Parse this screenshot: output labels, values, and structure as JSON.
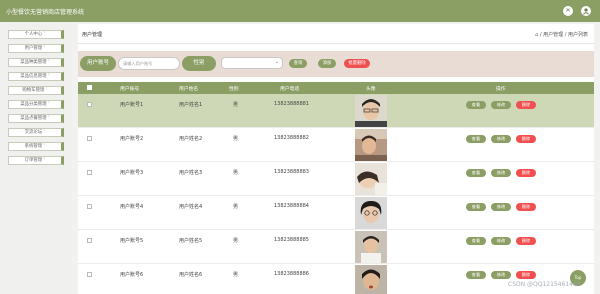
{
  "app": {
    "title": "小型餐饮无营销商店管理系统"
  },
  "topbar": {
    "icons": [
      "close-icon",
      "user-icon"
    ]
  },
  "sidebar": {
    "items": [
      {
        "label": "个人中心"
      },
      {
        "label": "用户管理"
      },
      {
        "label": "菜品种类管理"
      },
      {
        "label": "菜品信息管理"
      },
      {
        "label": "购物车管理"
      },
      {
        "label": "菜品分类管理"
      },
      {
        "label": "菜品点餐管理"
      },
      {
        "label": "交流论坛"
      },
      {
        "label": "系统管理"
      },
      {
        "label": "订单管理"
      }
    ]
  },
  "page": {
    "title": "用户管理",
    "breadcrumb": "⌂ / 用户管理 / 用户列表"
  },
  "filter": {
    "account_label": "用户账号",
    "account_placeholder": "请输入用户账号",
    "gender_label": "性别",
    "gender_value": "",
    "search_label": "查询",
    "add_label": "添加",
    "batch_delete_label": "批量删除"
  },
  "table": {
    "columns": [
      "",
      "用户账号",
      "用户姓名",
      "性别",
      "用户电话",
      "头像",
      "操作"
    ],
    "rows": [
      {
        "account": "用户账号1",
        "name": "用户姓名1",
        "gender": "男",
        "phone": "13823888881",
        "selected": true
      },
      {
        "account": "用户账号2",
        "name": "用户姓名2",
        "gender": "男",
        "phone": "13823888882",
        "selected": false
      },
      {
        "account": "用户账号3",
        "name": "用户姓名3",
        "gender": "男",
        "phone": "13823888883",
        "selected": false
      },
      {
        "account": "用户账号4",
        "name": "用户姓名4",
        "gender": "男",
        "phone": "13823888884",
        "selected": false
      },
      {
        "account": "用户账号5",
        "name": "用户姓名5",
        "gender": "男",
        "phone": "13823888885",
        "selected": false
      },
      {
        "account": "用户账号6",
        "name": "用户姓名6",
        "gender": "男",
        "phone": "13823888886",
        "selected": false
      }
    ],
    "actions": {
      "view": "查看",
      "edit": "修改",
      "delete": "删除"
    }
  },
  "fab": {
    "label": "Top"
  },
  "watermark": "CSDN @QQ1215461468",
  "colors": {
    "primary": "#8b9e64",
    "danger": "#f0504f",
    "filter_bg": "#e8dcd4",
    "row_selected": "#cfd8b6"
  }
}
